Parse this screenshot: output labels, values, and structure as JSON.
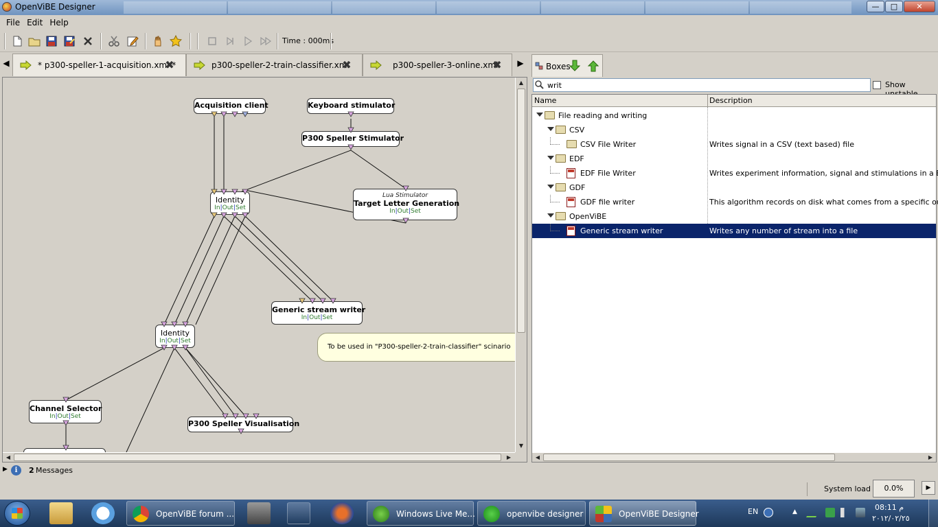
{
  "window": {
    "title": "OpenViBE Designer",
    "minimize_label": "—",
    "maximize_label": "□",
    "close_label": "✕"
  },
  "menu": [
    "File",
    "Edit",
    "Help"
  ],
  "toolbar": {
    "time_label": "Time : 000ms"
  },
  "tabs": [
    {
      "label": "* p300-speller-1-acquisition.xml *",
      "active": true
    },
    {
      "label": "p300-speller-2-train-classifier.xml",
      "active": false
    },
    {
      "label": "p300-speller-3-online.xml",
      "active": false
    }
  ],
  "scenario": {
    "boxes": [
      {
        "name": "Acquisition client",
        "sub": "",
        "io": false
      },
      {
        "name": "Keyboard stimulator",
        "sub": "",
        "io": false
      },
      {
        "name": "P300 Speller Stimulator",
        "sub": "",
        "io": false
      },
      {
        "name": "Identity",
        "sub": "",
        "io": true
      },
      {
        "name": "Target Letter Generation",
        "sub": "Lua Stimulator",
        "io": true
      },
      {
        "name": "Generic stream writer",
        "sub": "",
        "io": true
      },
      {
        "name": "Identity",
        "sub": "",
        "io": true
      },
      {
        "name": "Channel Selector",
        "sub": "",
        "io": true
      },
      {
        "name": "P300 Speller Visualisation",
        "sub": "",
        "io": false
      }
    ],
    "io_labels": {
      "in": "In",
      "out": "Out",
      "set": "Set",
      "sep": "|"
    },
    "note": "To be used in \"P300-speller-2-train-classifier\" scinario"
  },
  "boxes_panel": {
    "tab_label": "Boxes",
    "search_value": "writ",
    "show_unstable_label": "Show unstable",
    "show_unstable_checked": false,
    "columns": {
      "name": "Name",
      "description": "Description"
    },
    "rows": [
      {
        "name": "File reading and writing",
        "desc": "",
        "type": "folder",
        "level": 0,
        "expander": true,
        "selected": false
      },
      {
        "name": "CSV",
        "desc": "",
        "type": "folder",
        "level": 1,
        "expander": true,
        "selected": false
      },
      {
        "name": "CSV File Writer",
        "desc": "Writes signal in a CSV (text based) file",
        "type": "folder",
        "level": 2,
        "expander": false,
        "selected": false
      },
      {
        "name": "EDF",
        "desc": "",
        "type": "folder",
        "level": 1,
        "expander": true,
        "selected": false
      },
      {
        "name": "EDF File Writer",
        "desc": "Writes experiment information, signal and stimulations in a EDF file",
        "type": "file",
        "level": 2,
        "expander": false,
        "selected": false
      },
      {
        "name": "GDF",
        "desc": "",
        "type": "folder",
        "level": 1,
        "expander": true,
        "selected": false
      },
      {
        "name": "GDF file writer",
        "desc": "This algorithm records on disk what comes from a specific output",
        "type": "file",
        "level": 2,
        "expander": false,
        "selected": false
      },
      {
        "name": "OpenViBE",
        "desc": "",
        "type": "folder",
        "level": 1,
        "expander": true,
        "selected": false
      },
      {
        "name": "Generic stream writer",
        "desc": "Writes any number of stream into a file",
        "type": "file",
        "level": 2,
        "expander": false,
        "selected": true
      }
    ]
  },
  "messages": {
    "count": "2",
    "label": "Messages"
  },
  "status": {
    "system_load_label": "System load :",
    "system_load_value": "0.0%"
  },
  "taskbar": {
    "tasks": [
      {
        "label": "OpenViBE forum ...",
        "icon": "chrome-icon",
        "active": false
      },
      {
        "label": "Windows Live Me...",
        "icon": "messenger-icon",
        "active": false
      },
      {
        "label": "openvibe designer",
        "icon": "play-icon",
        "active": false
      },
      {
        "label": "OpenViBE Designer",
        "icon": "openvibe-icon",
        "active": true
      }
    ],
    "language": "EN",
    "time": "08:11 م",
    "date": "٢٠١٢/٠٢/٢٥"
  },
  "colors": {
    "selection": "#0a246a",
    "input_arrow": "#e8c87a",
    "stim_arrow": "#d8a6e0",
    "signal_arrow": "#a0b0e0",
    "note_bg": "#ffffe0"
  }
}
